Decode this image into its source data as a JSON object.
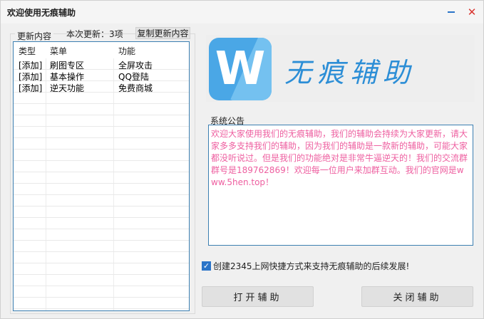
{
  "window": {
    "title": "欢迎使用无痕辅助",
    "minimize_icon": "minimize-icon",
    "close_icon": "close-icon",
    "close_glyph": "✕"
  },
  "updates": {
    "group_title": "更新内容",
    "count_text": "本次更新：3项",
    "copy_label": "复制更新内容",
    "columns": [
      "类型",
      "菜单",
      "功能"
    ],
    "rows": [
      [
        "[添加]",
        "刷图专区",
        "全屏攻击"
      ],
      [
        "[添加]",
        "基本操作",
        "QQ登陆"
      ],
      [
        "[添加]",
        "逆天功能",
        "免费商城"
      ]
    ]
  },
  "logo": {
    "letter": "W",
    "text": "无痕辅助",
    "accent": "#2c8ed6"
  },
  "notice": {
    "label": "系统公告",
    "text": "欢迎大家使用我们的无痕辅助，我们的辅助会持续为大家更新，请大家多多支持我们的辅助，因为我们的辅助是一款新的辅助，可能大家都没听说过。但是我们的功能绝对是非常牛逼逆天的！我们的交流群群号是189762869！欢迎每一位用户来加群互动。我们的官网是www.5hen.top！",
    "color": "#ee5fa0"
  },
  "shortcut": {
    "checked": true,
    "check_glyph": "✓",
    "label": "创建2345上网快捷方式来支持无痕辅助的后续发展!"
  },
  "actions": {
    "open_label": "打开辅助",
    "close_label": "关闭辅助"
  }
}
